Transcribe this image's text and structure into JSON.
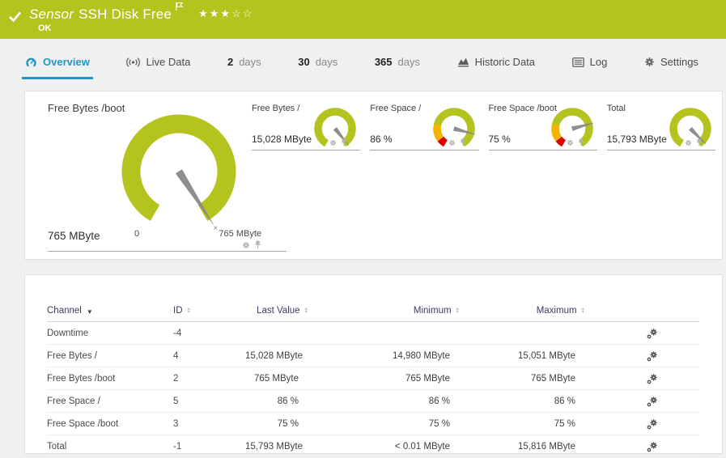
{
  "colors": {
    "brand_green": "#b5c31e",
    "accent_blue": "#1e96c8",
    "warning_yellow": "#f6b200",
    "error_red": "#dd0000",
    "needle_gray": "#8e8e8e"
  },
  "header": {
    "title_prefix": "Sensor",
    "title": "SSH Disk Free",
    "status": "OK",
    "rating_filled": 3,
    "rating_total": 5
  },
  "tabs": [
    {
      "id": "overview",
      "icon": "gauge",
      "label": "Overview",
      "active": true
    },
    {
      "id": "live-data",
      "icon": "live",
      "label": "Live Data",
      "active": false
    },
    {
      "id": "2-days",
      "num": "2",
      "label": "days",
      "active": false
    },
    {
      "id": "30-days",
      "num": "30",
      "label": "days",
      "active": false
    },
    {
      "id": "365-days",
      "num": "365",
      "label": "days",
      "active": false
    },
    {
      "id": "historic-data",
      "icon": "chart",
      "label": "Historic Data",
      "active": false
    },
    {
      "id": "log",
      "icon": "log",
      "label": "Log",
      "active": false
    },
    {
      "id": "settings",
      "icon": "gear",
      "label": "Settings",
      "active": false
    }
  ],
  "chart_data": [
    {
      "type": "gauge",
      "size": "large",
      "channel": "Free Bytes /boot",
      "value_label": "765 MByte",
      "value": 765,
      "unit": "MByte",
      "scale_min_label": "0",
      "scale_max_label": "765 MByte",
      "fraction": 0.99,
      "segments": [
        {
          "color": "#b5c31e",
          "from": 0,
          "to": 1
        }
      ]
    },
    {
      "type": "gauge",
      "size": "small",
      "channel": "Free Bytes /",
      "value_label": "15,028 MByte",
      "value": 15028,
      "unit": "MByte",
      "fraction": 0.97,
      "segments": [
        {
          "color": "#b5c31e",
          "from": 0,
          "to": 1
        }
      ]
    },
    {
      "type": "gauge",
      "size": "small",
      "channel": "Free Space /",
      "value_label": "86 %",
      "value": 86,
      "unit": "%",
      "fraction": 0.85,
      "segments": [
        {
          "color": "#dd0000",
          "from": 0,
          "to": 0.075
        },
        {
          "color": "#f6b200",
          "from": 0.075,
          "to": 0.24
        },
        {
          "color": "#b5c31e",
          "from": 0.24,
          "to": 1
        }
      ]
    },
    {
      "type": "gauge",
      "size": "small",
      "channel": "Free Space /boot",
      "value_label": "75 %",
      "value": 75,
      "unit": "%",
      "fraction": 0.75,
      "segments": [
        {
          "color": "#dd0000",
          "from": 0,
          "to": 0.075
        },
        {
          "color": "#f6b200",
          "from": 0.075,
          "to": 0.24
        },
        {
          "color": "#b5c31e",
          "from": 0.24,
          "to": 1
        }
      ]
    },
    {
      "type": "gauge",
      "size": "small",
      "channel": "Total",
      "value_label": "15,793 MByte",
      "value": 15793,
      "unit": "MByte",
      "fraction": 0.95,
      "segments": [
        {
          "color": "#b5c31e",
          "from": 0,
          "to": 1
        }
      ]
    }
  ],
  "table": {
    "columns": [
      {
        "key": "channel",
        "label": "Channel",
        "sorted": "desc",
        "align": "left"
      },
      {
        "key": "id",
        "label": "ID",
        "sortable": true,
        "align": "left"
      },
      {
        "key": "last_value",
        "label": "Last Value",
        "sortable": true,
        "align": "right"
      },
      {
        "key": "minimum",
        "label": "Minimum",
        "sortable": true,
        "align": "right"
      },
      {
        "key": "maximum",
        "label": "Maximum",
        "sortable": true,
        "align": "right"
      }
    ],
    "rows": [
      {
        "channel": "Downtime",
        "id": "-4",
        "last_value": "",
        "minimum": "",
        "maximum": ""
      },
      {
        "channel": "Free Bytes /",
        "id": "4",
        "last_value": "15,028 MByte",
        "minimum": "14,980 MByte",
        "maximum": "15,051 MByte"
      },
      {
        "channel": "Free Bytes /boot",
        "id": "2",
        "last_value": "765 MByte",
        "minimum": "765 MByte",
        "maximum": "765 MByte"
      },
      {
        "channel": "Free Space /",
        "id": "5",
        "last_value": "86 %",
        "minimum": "86 %",
        "maximum": "86 %"
      },
      {
        "channel": "Free Space /boot",
        "id": "3",
        "last_value": "75 %",
        "minimum": "75 %",
        "maximum": "75 %"
      },
      {
        "channel": "Total",
        "id": "-1",
        "last_value": "15,793 MByte",
        "minimum": "< 0.01 MByte",
        "maximum": "15,816 MByte"
      }
    ]
  }
}
